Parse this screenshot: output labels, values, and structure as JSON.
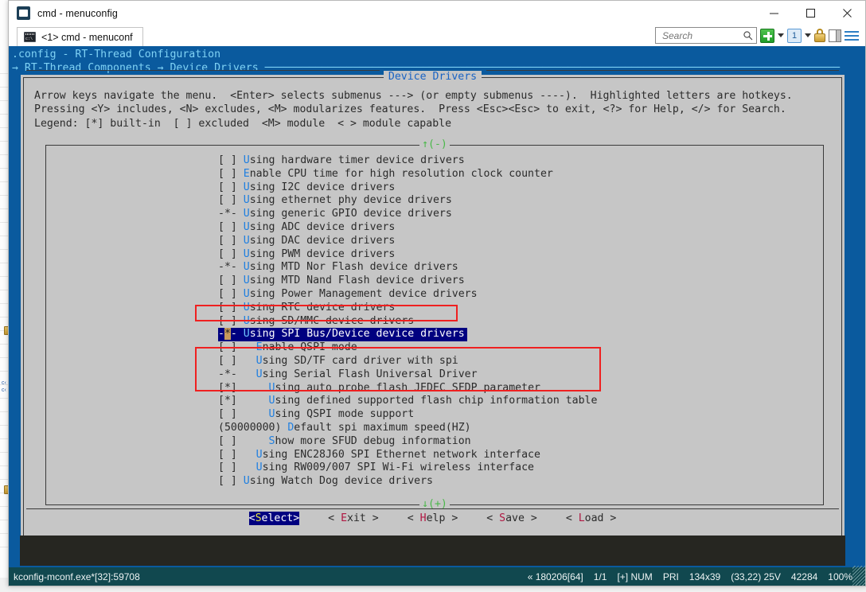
{
  "window": {
    "title": "cmd - menuconfig",
    "app_icon": "console-icon",
    "minimize": "minimize-icon",
    "maximize": "maximize-icon",
    "close": "close-icon"
  },
  "tab": {
    "label": "<1> cmd - menuconf",
    "icon": "cmd-icon"
  },
  "toolbar": {
    "search_placeholder": "Search",
    "search_value": "",
    "search_icon": "magnifier-icon",
    "new_tab_icon": "plus-icon",
    "new_tab_caret": "chevron-down-icon",
    "pane_label": "1",
    "pane_caret": "chevron-down-icon",
    "lock_icon": "lock-icon",
    "panel_icon": "split-panel-icon",
    "menu_icon": "hamburger-icon"
  },
  "breadcrumb": {
    "line1": ".config - RT-Thread Configuration",
    "line2": "→ RT-Thread Components → Device Drivers ───────────────────────────────────────────────────────────────────────────────────────────"
  },
  "dialog": {
    "title": "Device Drivers",
    "help_line1": "Arrow keys navigate the menu.  <Enter> selects submenus ---> (or empty submenus ----).  Highlighted letters are hotkeys.",
    "help_line2": "Pressing <Y> includes, <N> excludes, <M> modularizes features.  Press <Esc><Esc> to exit, <?> for Help, </> for Search.",
    "help_line3": "Legend: [*] built-in  [ ] excluded  <M> module  < > module capable",
    "scroll_up": "↑(-)",
    "scroll_down": "↓(+)"
  },
  "menu": {
    "items": [
      {
        "flag": "[ ] ",
        "indent": "",
        "hk": "U",
        "rest": "sing hardware timer device drivers",
        "selected": false
      },
      {
        "flag": "[ ] ",
        "indent": "",
        "hk": "E",
        "rest": "nable CPU time for high resolution clock counter",
        "selected": false
      },
      {
        "flag": "[ ] ",
        "indent": "",
        "hk": "U",
        "rest": "sing I2C device drivers",
        "selected": false
      },
      {
        "flag": "[ ] ",
        "indent": "",
        "hk": "U",
        "rest": "sing ethernet phy device drivers",
        "selected": false
      },
      {
        "flag": "-*- ",
        "indent": "",
        "hk": "U",
        "rest": "sing generic GPIO device drivers",
        "selected": false
      },
      {
        "flag": "[ ] ",
        "indent": "",
        "hk": "U",
        "rest": "sing ADC device drivers",
        "selected": false
      },
      {
        "flag": "[ ] ",
        "indent": "",
        "hk": "U",
        "rest": "sing DAC device drivers",
        "selected": false
      },
      {
        "flag": "[ ] ",
        "indent": "",
        "hk": "U",
        "rest": "sing PWM device drivers",
        "selected": false
      },
      {
        "flag": "-*- ",
        "indent": "",
        "hk": "U",
        "rest": "sing MTD Nor Flash device drivers",
        "selected": false
      },
      {
        "flag": "[ ] ",
        "indent": "",
        "hk": "U",
        "rest": "sing MTD Nand Flash device drivers",
        "selected": false
      },
      {
        "flag": "[ ] ",
        "indent": "",
        "hk": "U",
        "rest": "sing Power Management device drivers",
        "selected": false
      },
      {
        "flag": "[ ] ",
        "indent": "",
        "hk": "U",
        "rest": "sing RTC device drivers",
        "selected": false
      },
      {
        "flag": "[ ] ",
        "indent": "",
        "hk": "U",
        "rest": "sing SD/MMC device drivers",
        "selected": false
      },
      {
        "flag": "-*- ",
        "indent": "",
        "hk": "U",
        "rest": "sing SPI Bus/Device device drivers",
        "selected": true
      },
      {
        "flag": "[ ] ",
        "indent": "  ",
        "hk": "E",
        "rest": "nable QSPI mode",
        "selected": false
      },
      {
        "flag": "[ ] ",
        "indent": "  ",
        "hk": "U",
        "rest": "sing SD/TF card driver with spi",
        "selected": false
      },
      {
        "flag": "-*- ",
        "indent": "  ",
        "hk": "U",
        "rest": "sing Serial Flash Universal Driver",
        "selected": false
      },
      {
        "flag": "[*] ",
        "indent": "    ",
        "hk": "U",
        "rest": "sing auto probe flash JEDEC SFDP parameter",
        "selected": false
      },
      {
        "flag": "[*] ",
        "indent": "    ",
        "hk": "U",
        "rest": "sing defined supported flash chip information table",
        "selected": false
      },
      {
        "flag": "[ ] ",
        "indent": "    ",
        "hk": "U",
        "rest": "sing QSPI mode support",
        "selected": false
      },
      {
        "flag": "(50000000) ",
        "indent": "",
        "hk": "D",
        "rest": "efault spi maximum speed(HZ)",
        "selected": false
      },
      {
        "flag": "[ ] ",
        "indent": "    ",
        "hk": "S",
        "rest": "how more SFUD debug information",
        "selected": false
      },
      {
        "flag": "[ ] ",
        "indent": "  ",
        "hk": "U",
        "rest": "sing ENC28J60 SPI Ethernet network interface",
        "selected": false
      },
      {
        "flag": "[ ] ",
        "indent": "  ",
        "hk": "U",
        "rest": "sing RW009/007 SPI Wi-Fi wireless interface",
        "selected": false
      },
      {
        "flag": "[ ] ",
        "indent": "",
        "hk": "U",
        "rest": "sing Watch Dog device drivers",
        "selected": false
      }
    ]
  },
  "buttons": [
    {
      "name": "select",
      "open": "<",
      "hk": "S",
      "rest": "elect",
      "close": ">",
      "primary": true
    },
    {
      "name": "exit",
      "open": "< ",
      "hk": "E",
      "rest": "xit",
      "close": " >",
      "primary": false
    },
    {
      "name": "help",
      "open": "< ",
      "hk": "H",
      "rest": "elp",
      "close": " >",
      "primary": false
    },
    {
      "name": "save",
      "open": "< ",
      "hk": "S",
      "rest": "ave",
      "close": " >",
      "primary": false
    },
    {
      "name": "load",
      "open": "< ",
      "hk": "L",
      "rest": "oad",
      "close": " >",
      "primary": false
    }
  ],
  "statusbar": {
    "left": "kconfig-mconf.exe*[32]:59708",
    "items": [
      "« 180206[64]",
      "1/1",
      "[+] NUM",
      "PRI",
      "134x39",
      "(33,22) 25V",
      "42284",
      "100%"
    ]
  },
  "colors": {
    "console_bg": "#0a5a9e",
    "dialog_bg": "#c6c6c6",
    "hotkey": "#1f7fe0",
    "selection": "#000080",
    "annotation": "#ef2020",
    "status_bg": "#11484f"
  },
  "annotations": [
    {
      "name": "spi-bus-highlight-box"
    },
    {
      "name": "sfud-options-box"
    }
  ]
}
